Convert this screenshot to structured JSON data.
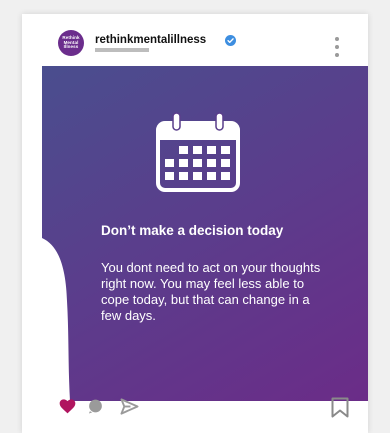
{
  "post": {
    "account": "rethinkmentalillness",
    "avatar_text": "Rethink\nMental\nIllness",
    "headline": "Don’t make a decision today",
    "body": "You dont need to act on your thoughts right now. You may feel less able to cope today, but that can change in a few days."
  },
  "icons": {
    "verified": "verified-badge-icon",
    "more": "more-options-icon",
    "calendar": "calendar-icon",
    "like": "heart-icon",
    "comment": "comment-icon",
    "share": "share-icon",
    "save": "bookmark-icon"
  },
  "colors": {
    "brand": "#6b2d8c",
    "like": "#b0155f",
    "verified": "#3d8ee0"
  }
}
